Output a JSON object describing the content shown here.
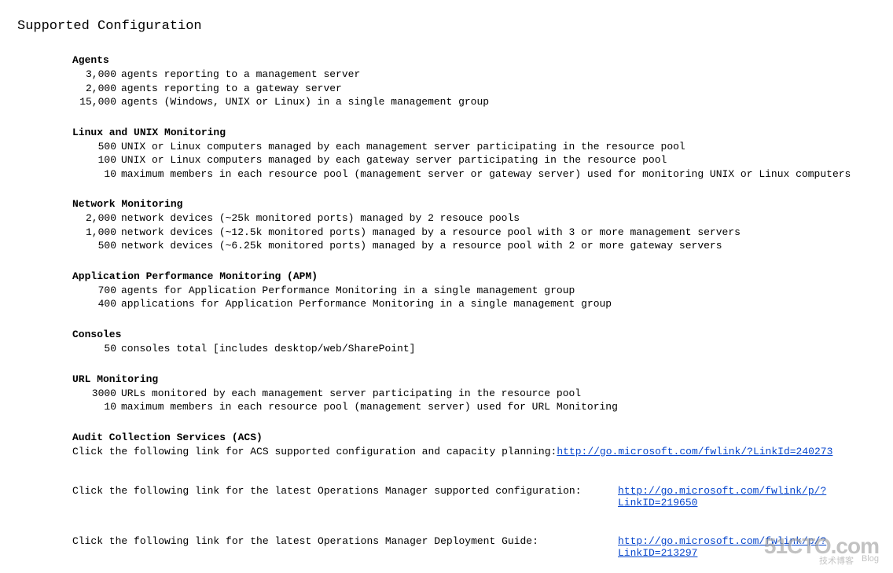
{
  "title": "Supported Configuration",
  "sections": [
    {
      "heading": "Agents",
      "rows": [
        {
          "n": "3,000",
          "d": "agents reporting to a management server"
        },
        {
          "n": "2,000",
          "d": "agents reporting to a gateway server"
        },
        {
          "n": "15,000",
          "d": "agents (Windows, UNIX or Linux) in a single management group"
        }
      ]
    },
    {
      "heading": "Linux and UNIX Monitoring",
      "rows": [
        {
          "n": "500",
          "d": "UNIX or Linux computers managed by each management server participating in the resource pool"
        },
        {
          "n": "100",
          "d": "UNIX or Linux computers managed by each gateway server participating in the resource pool"
        },
        {
          "n": "10",
          "d": "maximum members in each resource pool (management server or gateway server) used for monitoring UNIX or Linux computers"
        }
      ]
    },
    {
      "heading": "Network Monitoring",
      "rows": [
        {
          "n": "2,000",
          "d": "network devices (~25k monitored ports) managed by 2 resouce pools"
        },
        {
          "n": "1,000",
          "d": "network devices (~12.5k monitored ports) managed by a resource pool with 3 or more management servers"
        },
        {
          "n": "500",
          "d": "network devices (~6.25k monitored ports) managed by a resource pool with 2 or more gateway servers"
        }
      ]
    },
    {
      "heading": "Application Performance Monitoring (APM)",
      "rows": [
        {
          "n": "700",
          "d": "agents for Application Performance Monitoring in a single management group"
        },
        {
          "n": "400",
          "d": "applications for Application Performance Monitoring in a single management group"
        }
      ]
    },
    {
      "heading": "Consoles",
      "rows": [
        {
          "n": "50",
          "d": "consoles total [includes desktop/web/SharePoint]"
        }
      ]
    },
    {
      "heading": "URL Monitoring",
      "rows": [
        {
          "n": "3000",
          "d": "URLs monitored by each management server participating in the resource pool"
        },
        {
          "n": "10",
          "d": "maximum members in each resource pool (management server) used for URL Monitoring"
        }
      ]
    }
  ],
  "acs": {
    "heading": "Audit Collection Services (ACS)",
    "label": "Click the following link for ACS supported configuration and capacity planning:  ",
    "url": "http://go.microsoft.com/fwlink/?LinkId=240273"
  },
  "links": [
    {
      "label": "Click the following link for the latest Operations Manager supported configuration:",
      "url": "http://go.microsoft.com/fwlink/p/?LinkID=219650"
    },
    {
      "label": "Click the following link for the latest Operations Manager Deployment Guide:   ",
      "url": "http://go.microsoft.com/fwlink/p/?LinkID=213297"
    }
  ],
  "watermark": {
    "main": "51CTO.com",
    "sub1": "技术博客",
    "sub2": "Blog"
  }
}
